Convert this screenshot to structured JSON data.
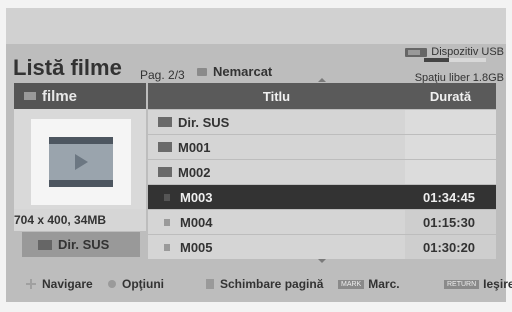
{
  "header": {
    "title": "Listă filme",
    "page": "Pag. 2/3",
    "mark_status": "Nemarcat"
  },
  "device": {
    "label": "Dispozitiv USB",
    "free_space": "Spaţiu liber 1.8GB",
    "usage_fraction": 0.4
  },
  "sidebar": {
    "section": "filme",
    "resolution": "704 x 400, 34MB",
    "dir_button": "Dir. SUS"
  },
  "table": {
    "col_title": "Titlu",
    "col_duration": "Durată",
    "rows": [
      {
        "title": "Dir. SUS",
        "duration": "",
        "type": "folder"
      },
      {
        "title": "M001",
        "duration": "",
        "type": "folder"
      },
      {
        "title": "M002",
        "duration": "",
        "type": "folder"
      },
      {
        "title": "M003",
        "duration": "01:34:45",
        "type": "file",
        "selected": true
      },
      {
        "title": "M004",
        "duration": "01:15:30",
        "type": "file"
      },
      {
        "title": "M005",
        "duration": "01:30:20",
        "type": "file"
      }
    ]
  },
  "footer": {
    "navigate": "Navigare",
    "options": "Opţiuni",
    "change_page": "Schimbare pagină",
    "mark_key": "MARK",
    "mark": "Marc.",
    "return_key": "RETURN",
    "exit": "Ieşire"
  }
}
